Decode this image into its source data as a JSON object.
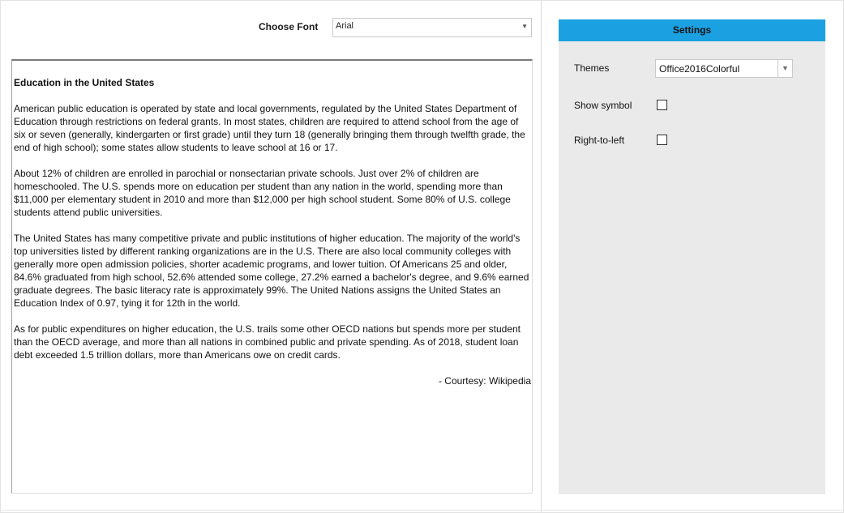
{
  "font_selector": {
    "label": "Choose Font",
    "value": "Arial"
  },
  "document": {
    "title": "Education in the United States",
    "paragraphs": [
      "American public education is operated by state and local governments, regulated by the United States Department of Education through restrictions on federal grants. In most states, children are required to attend school from the age of six or seven (generally, kindergarten or first grade) until they turn 18 (generally bringing them through twelfth grade, the end of high school); some states allow students to leave school at 16 or 17.",
      "About 12% of children are enrolled in parochial or nonsectarian private schools. Just over 2% of children are homeschooled. The U.S. spends more on education per student than any nation in the world, spending more than $11,000 per elementary student in 2010 and more than $12,000 per high school student. Some 80% of U.S. college students attend public universities.",
      "The United States has many competitive private and public institutions of higher education. The majority of the world's top universities listed by different ranking organizations are in the U.S. There are also local community colleges with generally more open admission policies, shorter academic programs, and lower tuition. Of Americans 25 and older, 84.6% graduated from high school, 52.6% attended some college, 27.2% earned a bachelor's degree, and 9.6% earned graduate degrees. The basic literacy rate is approximately 99%. The United Nations assigns the United States an Education Index of 0.97, tying it for 12th in the world.",
      "As for public expenditures on higher education, the U.S. trails some other OECD nations but spends more per student than the OECD average, and more than all nations in combined public and private spending. As of 2018, student loan debt exceeded 1.5 trillion dollars, more than Americans owe on credit cards."
    ],
    "courtesy": "- Courtesy: Wikipedia"
  },
  "settings": {
    "header": "Settings",
    "themes_label": "Themes",
    "themes_value": "Office2016Colorful",
    "show_symbol_label": "Show symbol",
    "show_symbol_checked": false,
    "rtl_label": "Right-to-left",
    "rtl_checked": false
  },
  "colors": {
    "accent": "#1ba1e2",
    "panel_bg": "#eaeaea"
  },
  "icons": {
    "font_dropdown": "chevron-down-icon",
    "themes_dropdown": "triangle-down-icon"
  }
}
